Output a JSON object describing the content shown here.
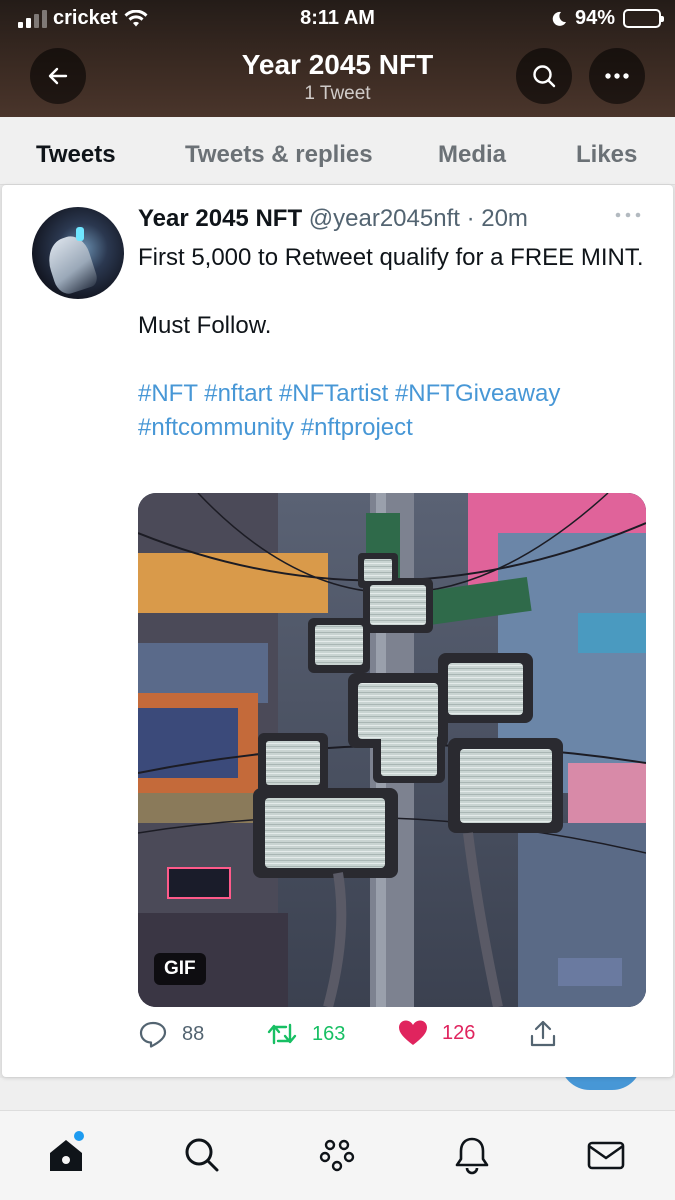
{
  "status_bar": {
    "carrier": "cricket",
    "time": "8:11 AM",
    "battery": "94%",
    "battery_level": 0.94
  },
  "header": {
    "title": "Year 2045 NFT",
    "subtitle": "1 Tweet"
  },
  "tabs": [
    {
      "label": "Tweets",
      "active": true
    },
    {
      "label": "Tweets & replies",
      "active": false
    },
    {
      "label": "Media",
      "active": false
    },
    {
      "label": "Likes",
      "active": false
    }
  ],
  "tweet": {
    "display_name": "Year 2045 NFT",
    "meta": "@year2045nft · 20m",
    "lines": [
      "First 5,000 to Retweet qualify for a FREE MINT.",
      "Must Follow."
    ],
    "hashtags": "#NFT #nftart #NFTartist #NFTGiveaway #nftcommunity #nftproject",
    "media_badge": "GIF",
    "reply_count": "88",
    "retweet_count": "163",
    "like_count": "126"
  },
  "colors": {
    "link": "#4797d6",
    "retweet": "#17bf63",
    "like": "#e0245e",
    "accent": "#1d9bf0"
  }
}
